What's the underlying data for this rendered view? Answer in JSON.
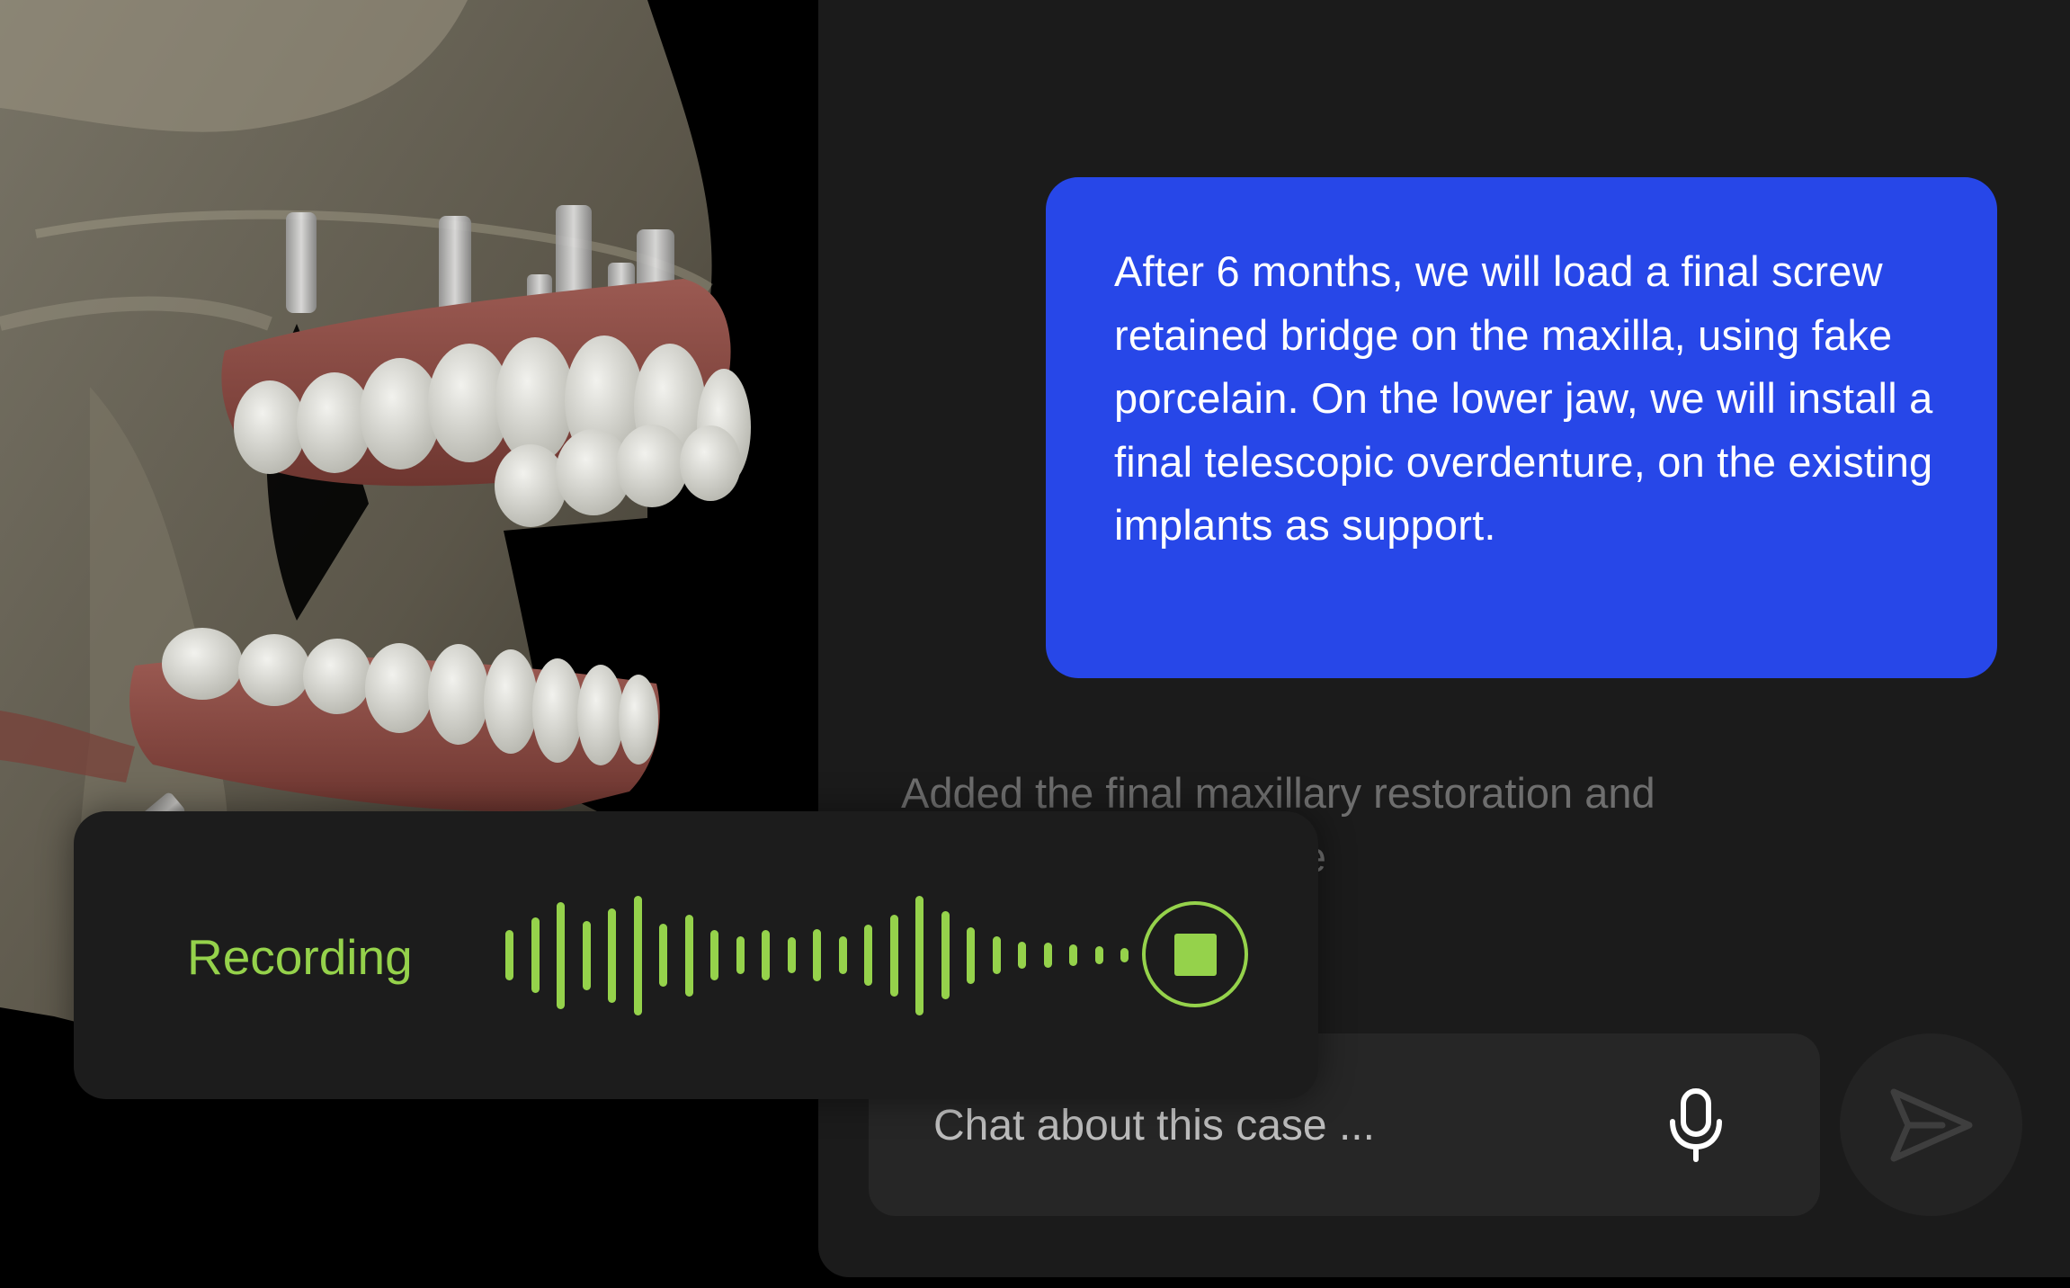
{
  "viewport": {
    "alt": "3D model of skull with maxillary implants and upper and lower prostheses"
  },
  "chat": {
    "user_message": "After 6 months, we will load a final screw retained bridge on the maxilla, using fake porcelain. On the lower jaw, we will install a final telescopic overdenture, on the existing implants as support.",
    "assistant_message": "Added the final maxillary restoration and telescopic overdenture",
    "composer": {
      "placeholder": "Chat about this case ..."
    }
  },
  "recording": {
    "label": "Recording",
    "waveform_levels": [
      0.4,
      0.6,
      0.85,
      0.55,
      0.75,
      0.95,
      0.5,
      0.65,
      0.4,
      0.3,
      0.4,
      0.28,
      0.42,
      0.3,
      0.48,
      0.65,
      0.95,
      0.7,
      0.45,
      0.3,
      0.22,
      0.2,
      0.17,
      0.14,
      0.12
    ]
  },
  "colors": {
    "accent_green": "#95d24b",
    "user_bubble": "#2747e8",
    "panel_bg": "#1b1b1b"
  },
  "icons": {
    "mic": "microphone-icon",
    "send": "send-arrow-icon",
    "stop": "stop-square-icon"
  }
}
